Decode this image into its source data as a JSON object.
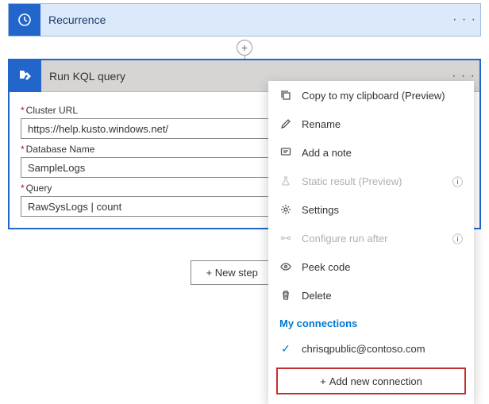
{
  "recurrence": {
    "title": "Recurrence"
  },
  "kql": {
    "title": "Run KQL query",
    "fields": {
      "cluster_label": "Cluster URL",
      "cluster_value": "https://help.kusto.windows.net/",
      "database_label": "Database Name",
      "database_value": "SampleLogs",
      "query_label": "Query",
      "query_value": "RawSysLogs | count"
    }
  },
  "new_step_label": "+ New step",
  "menu": {
    "copy": "Copy to my clipboard (Preview)",
    "rename": "Rename",
    "note": "Add a note",
    "static": "Static result (Preview)",
    "settings": "Settings",
    "configure": "Configure run after",
    "peek": "Peek code",
    "delete": "Delete",
    "connections_header": "My connections",
    "connection_email": "chrisqpublic@contoso.com",
    "add_connection": "Add new connection"
  }
}
